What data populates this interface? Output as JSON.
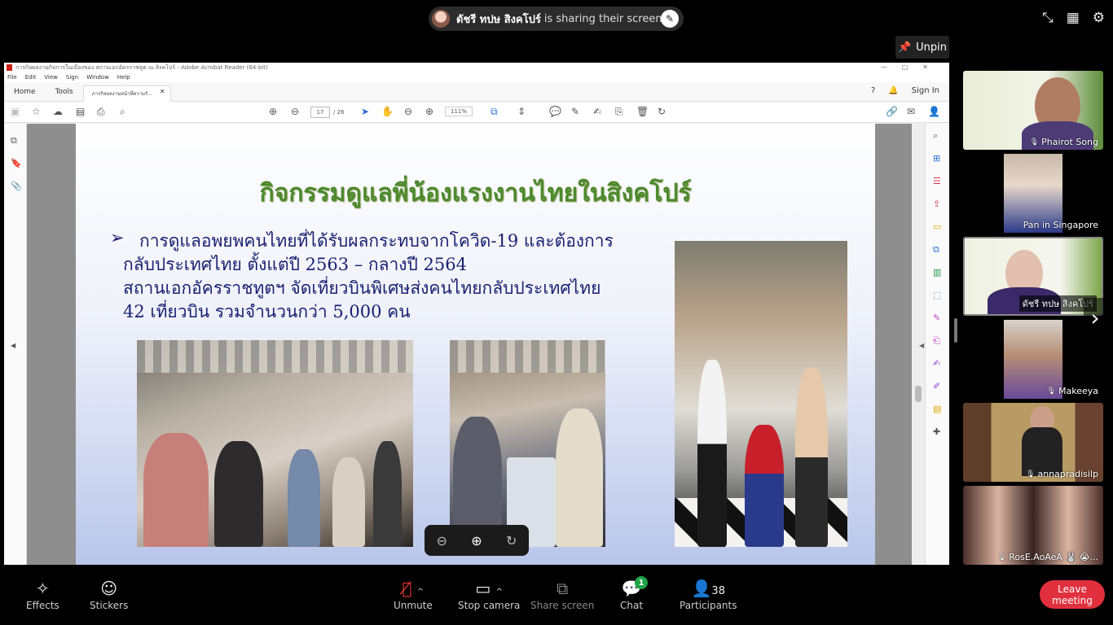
{
  "share_banner": {
    "presenter": "ดัชรี ทปษ สิงคโปร์",
    "suffix": "is sharing their screen."
  },
  "unpin": {
    "label": "Unpin",
    "icon": "pin-icon"
  },
  "acrobat": {
    "window_title": "การกิจผลงานกิจการในเมืองของ สถานเอกอัครราชทูต ณ สิงคโปร์ - Adobe Acrobat Reader (64-bit)",
    "menu": [
      "File",
      "Edit",
      "View",
      "Sign",
      "Window",
      "Help"
    ],
    "tabs": {
      "home": "Home",
      "tools": "Tools",
      "document": "ภารกิจผลงานหน้าที่ความรั..."
    },
    "sign_in": "Sign In",
    "page_current": "17",
    "page_total": "/ 26",
    "zoom": "111%"
  },
  "slide": {
    "title": "กิจกรรมดูแลพี่น้องแรงงานไทยในสิงคโปร์",
    "bullet": "➢",
    "lines": [
      "การดูแลอพยพคนไทยที่ได้รับผลกระทบจากโควิด-19 และต้องการ",
      "กลับประเทศไทย ตั้งแต่ปี 2563 – กลางปี 2564",
      "สถานเอกอัครราชทูตฯ จัดเที่ยวบินพิเศษส่งคนไทยกลับประเทศไทย",
      "42 เที่ยวบิน รวมจำนวนกว่า 5,000 คน"
    ]
  },
  "participants": [
    {
      "name": "Phairot Song"
    },
    {
      "name": "Pan in Singapore"
    },
    {
      "name": "ดัชรี ทปษ สิงคโปร์"
    },
    {
      "name": "Makeeya"
    },
    {
      "name": "annapradisilp"
    },
    {
      "name": "RosE.AoAeA 🐰 😭..."
    }
  ],
  "toolbar": {
    "effects": "Effects",
    "stickers": "Stickers",
    "unmute": "Unmute",
    "stop_camera": "Stop camera",
    "share_screen": "Share screen",
    "chat": "Chat",
    "chat_badge": "1",
    "participants": "Participants",
    "participants_count": "38",
    "leave": "Leave meeting"
  },
  "colors": {
    "leave": "#e0303e",
    "chat_badge": "#1ea446",
    "slide_title": "#4d8a2e",
    "slide_text": "#1d2070"
  }
}
